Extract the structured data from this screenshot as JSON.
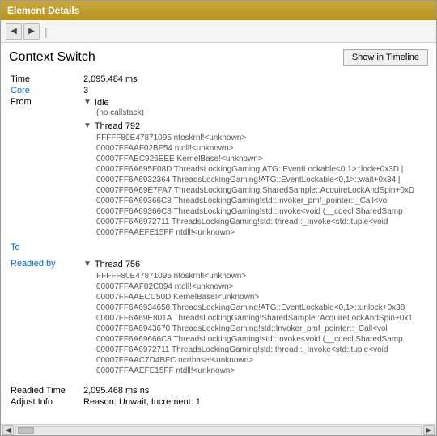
{
  "window": {
    "title": "Element Details"
  },
  "toolbar": {
    "back_label": "◄",
    "forward_label": "►",
    "separator": "|"
  },
  "header": {
    "title": "Context Switch",
    "show_timeline_label": "Show in Timeline"
  },
  "fields": {
    "time_label": "Time",
    "time_value": "2,095.484 ms",
    "core_label": "Core",
    "core_value": "3",
    "from_label": "From",
    "from_value_idle": "Idle",
    "from_value_callstack": "(no callstack)",
    "to_label": "To",
    "to_thread": "Thread 792",
    "to_stack": [
      "FFFFF80E47871095  ntoskrnl!<unknown>",
      "00007FFAAF02BF54  ntdll!<unknown>",
      "00007FFAEC926EE  KernelBase!<unknown>",
      "00007FF6A695F08D  ThreadsLockingGaming!ATG::EventLockable<0,1>::lock+0x3D",
      "00007FF6A6932364  ThreadsLockingGaming!ATG::EventLockable<0,1>::wait+0x34",
      "00007FF6A69E7FA7  ThreadsLockingGaming!SharedSample::AcquireLockAndSpin+0xD",
      "00007FF6A69366C8  ThreadsLockingGaming!std::Invoker_pmf_pointer::_Call<vol",
      "00007FF6A69366C8  ThreadsLockingGaming!std::Invoke<void (__cdecl SharedSamp",
      "00007FF6A6972711  ThreadsLockingGaming!std::thread::_Invoke<std::tuple<void",
      "00007FFAAEFE15FF  ntdll!<unknown>"
    ],
    "readied_by_label": "Readied by",
    "readied_by_thread": "Thread 756",
    "readied_by_stack": [
      "FFFFF80E47871095  ntoskrnl!<unknown>",
      "00007FFAAF02C094  ntdll!<unknown>",
      "00007FFAAECE50D  KernelBase!<unknown>",
      "00007FF6A6934658  ThreadsLockingGaming!ATG::EventLockable<0,1>::unlock+0x38",
      "00007FF6A69E801A  ThreadsLockingGaming!SharedSample::AcquireLockAndSpin+0x1",
      "00007FF6A6943670  ThreadsLockingGaming!std::Invoker_pmf_pointer::_Call<vol",
      "00007FF6A69666C8  ThreadsLockingGaming!std::Invoke<void (__cdecl SharedSamp",
      "00007FF6A6972711  ThreadsLockingGaming!std::thread::_Invoke<std::tuple<void",
      "00007FFAAC7D4BFC  ucrtbase!<unknown>",
      "00007FFAAEFE15FF  ntdll!<unknown>"
    ],
    "readied_time_label": "Readied Time",
    "readied_time_value": "2,095.468 ms ns",
    "adjust_info_label": "Adjust Info",
    "adjust_info_value": "Reason: Unwait, Increment: 1"
  }
}
